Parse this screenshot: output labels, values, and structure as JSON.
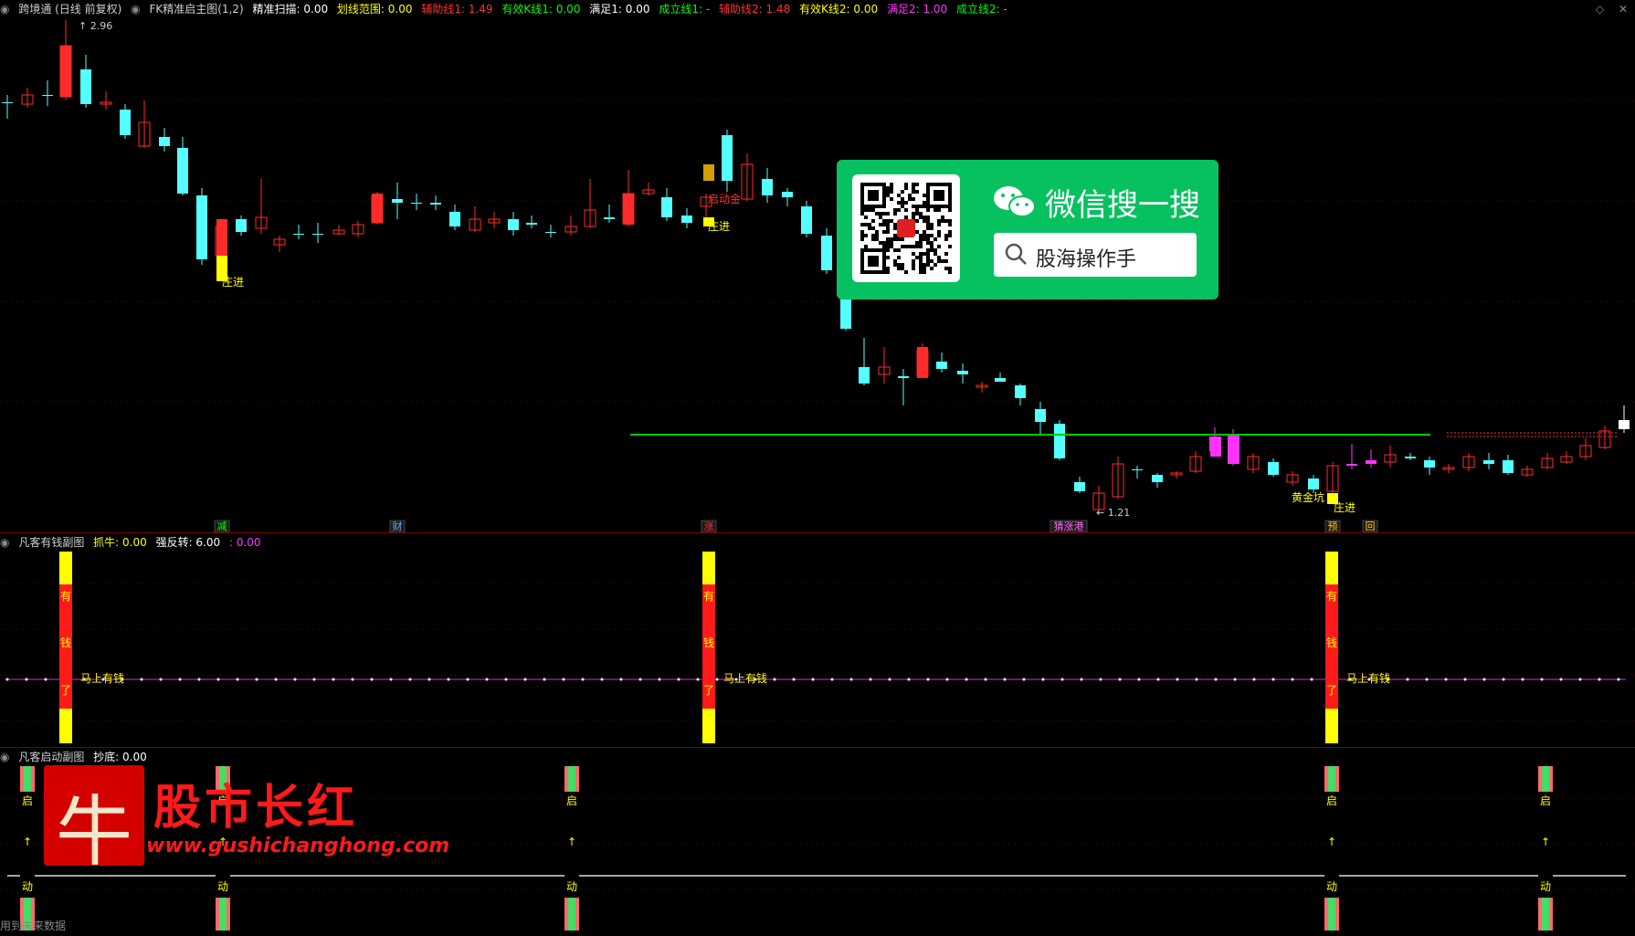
{
  "main_pane": {
    "header": [
      {
        "text": "跨境通 (日线 前复权)",
        "color": "#cfcfcf"
      },
      {
        "text": "FK精准启主图(1,2)",
        "color": "#cfcfcf"
      },
      {
        "text": "精准扫描: 0.00",
        "color": "#ffffff"
      },
      {
        "text": "划线范围: 0.00",
        "color": "#ffff00"
      },
      {
        "text": "辅助线1: 1.49",
        "color": "#ff3030"
      },
      {
        "text": "有效K线1: 0.00",
        "color": "#00ff00"
      },
      {
        "text": "满足1: 0.00",
        "color": "#ffffff"
      },
      {
        "text": "成立线1: -",
        "color": "#00ff00"
      },
      {
        "text": "辅助线2: 1.48",
        "color": "#ff3030"
      },
      {
        "text": "有效K线2: 0.00",
        "color": "#ffff00"
      },
      {
        "text": "满足2: 1.00",
        "color": "#ff33ff"
      },
      {
        "text": "成立线2: -",
        "color": "#00ff00"
      }
    ],
    "labels": [
      {
        "text": "2.96",
        "color": "#cccccc"
      },
      {
        "text": "1.21",
        "color": "#cccccc"
      },
      {
        "text": "庄进",
        "color": "#ffff00"
      },
      {
        "text": "启动金",
        "color": "#ff3030"
      },
      {
        "text": "庄进",
        "color": "#ffff00"
      },
      {
        "text": "黄金坑",
        "color": "#ffff00"
      },
      {
        "text": "庄进",
        "color": "#ffff00"
      }
    ],
    "bottom_tags": [
      {
        "text": "减",
        "color": "#00ff00"
      },
      {
        "text": "财",
        "color": "#66aaff"
      },
      {
        "text": "涨",
        "color": "#ff3030"
      },
      {
        "text": "猜涨港",
        "color": "#ff66ff"
      },
      {
        "text": "预",
        "color": "#ffcc00"
      },
      {
        "text": "回",
        "color": "#ffcc00"
      }
    ]
  },
  "pane2": {
    "header": [
      {
        "text": "凡客有钱副图",
        "color": "#cfcfcf"
      },
      {
        "text": "抓牛: 0.00",
        "color": "#ffff00"
      },
      {
        "text": "强反转: 6.00",
        "color": "#ffffff"
      },
      {
        "text": ": 0.00",
        "color": "#ff33ff"
      }
    ],
    "bar_chars": [
      "有",
      "钱",
      "了"
    ],
    "line_label": "马上有钱"
  },
  "pane3": {
    "header": [
      {
        "text": "凡客启动副图",
        "color": "#cfcfcf"
      },
      {
        "text": "抄底: 0.00",
        "color": "#ffffff"
      }
    ],
    "top_char": "启",
    "arrow": "↑",
    "bottom_char": "动"
  },
  "ad": {
    "title": "微信搜一搜",
    "search_text": "股海操作手"
  },
  "brand": {
    "logo_char": "牛",
    "title": "股市长红",
    "url": "www.gushichanghong.com"
  },
  "footer": "用到未来数据",
  "colors": {
    "up": "#ff2b2b",
    "down": "#54ffff",
    "support": "#00c800",
    "grid": "#7a0000"
  }
}
